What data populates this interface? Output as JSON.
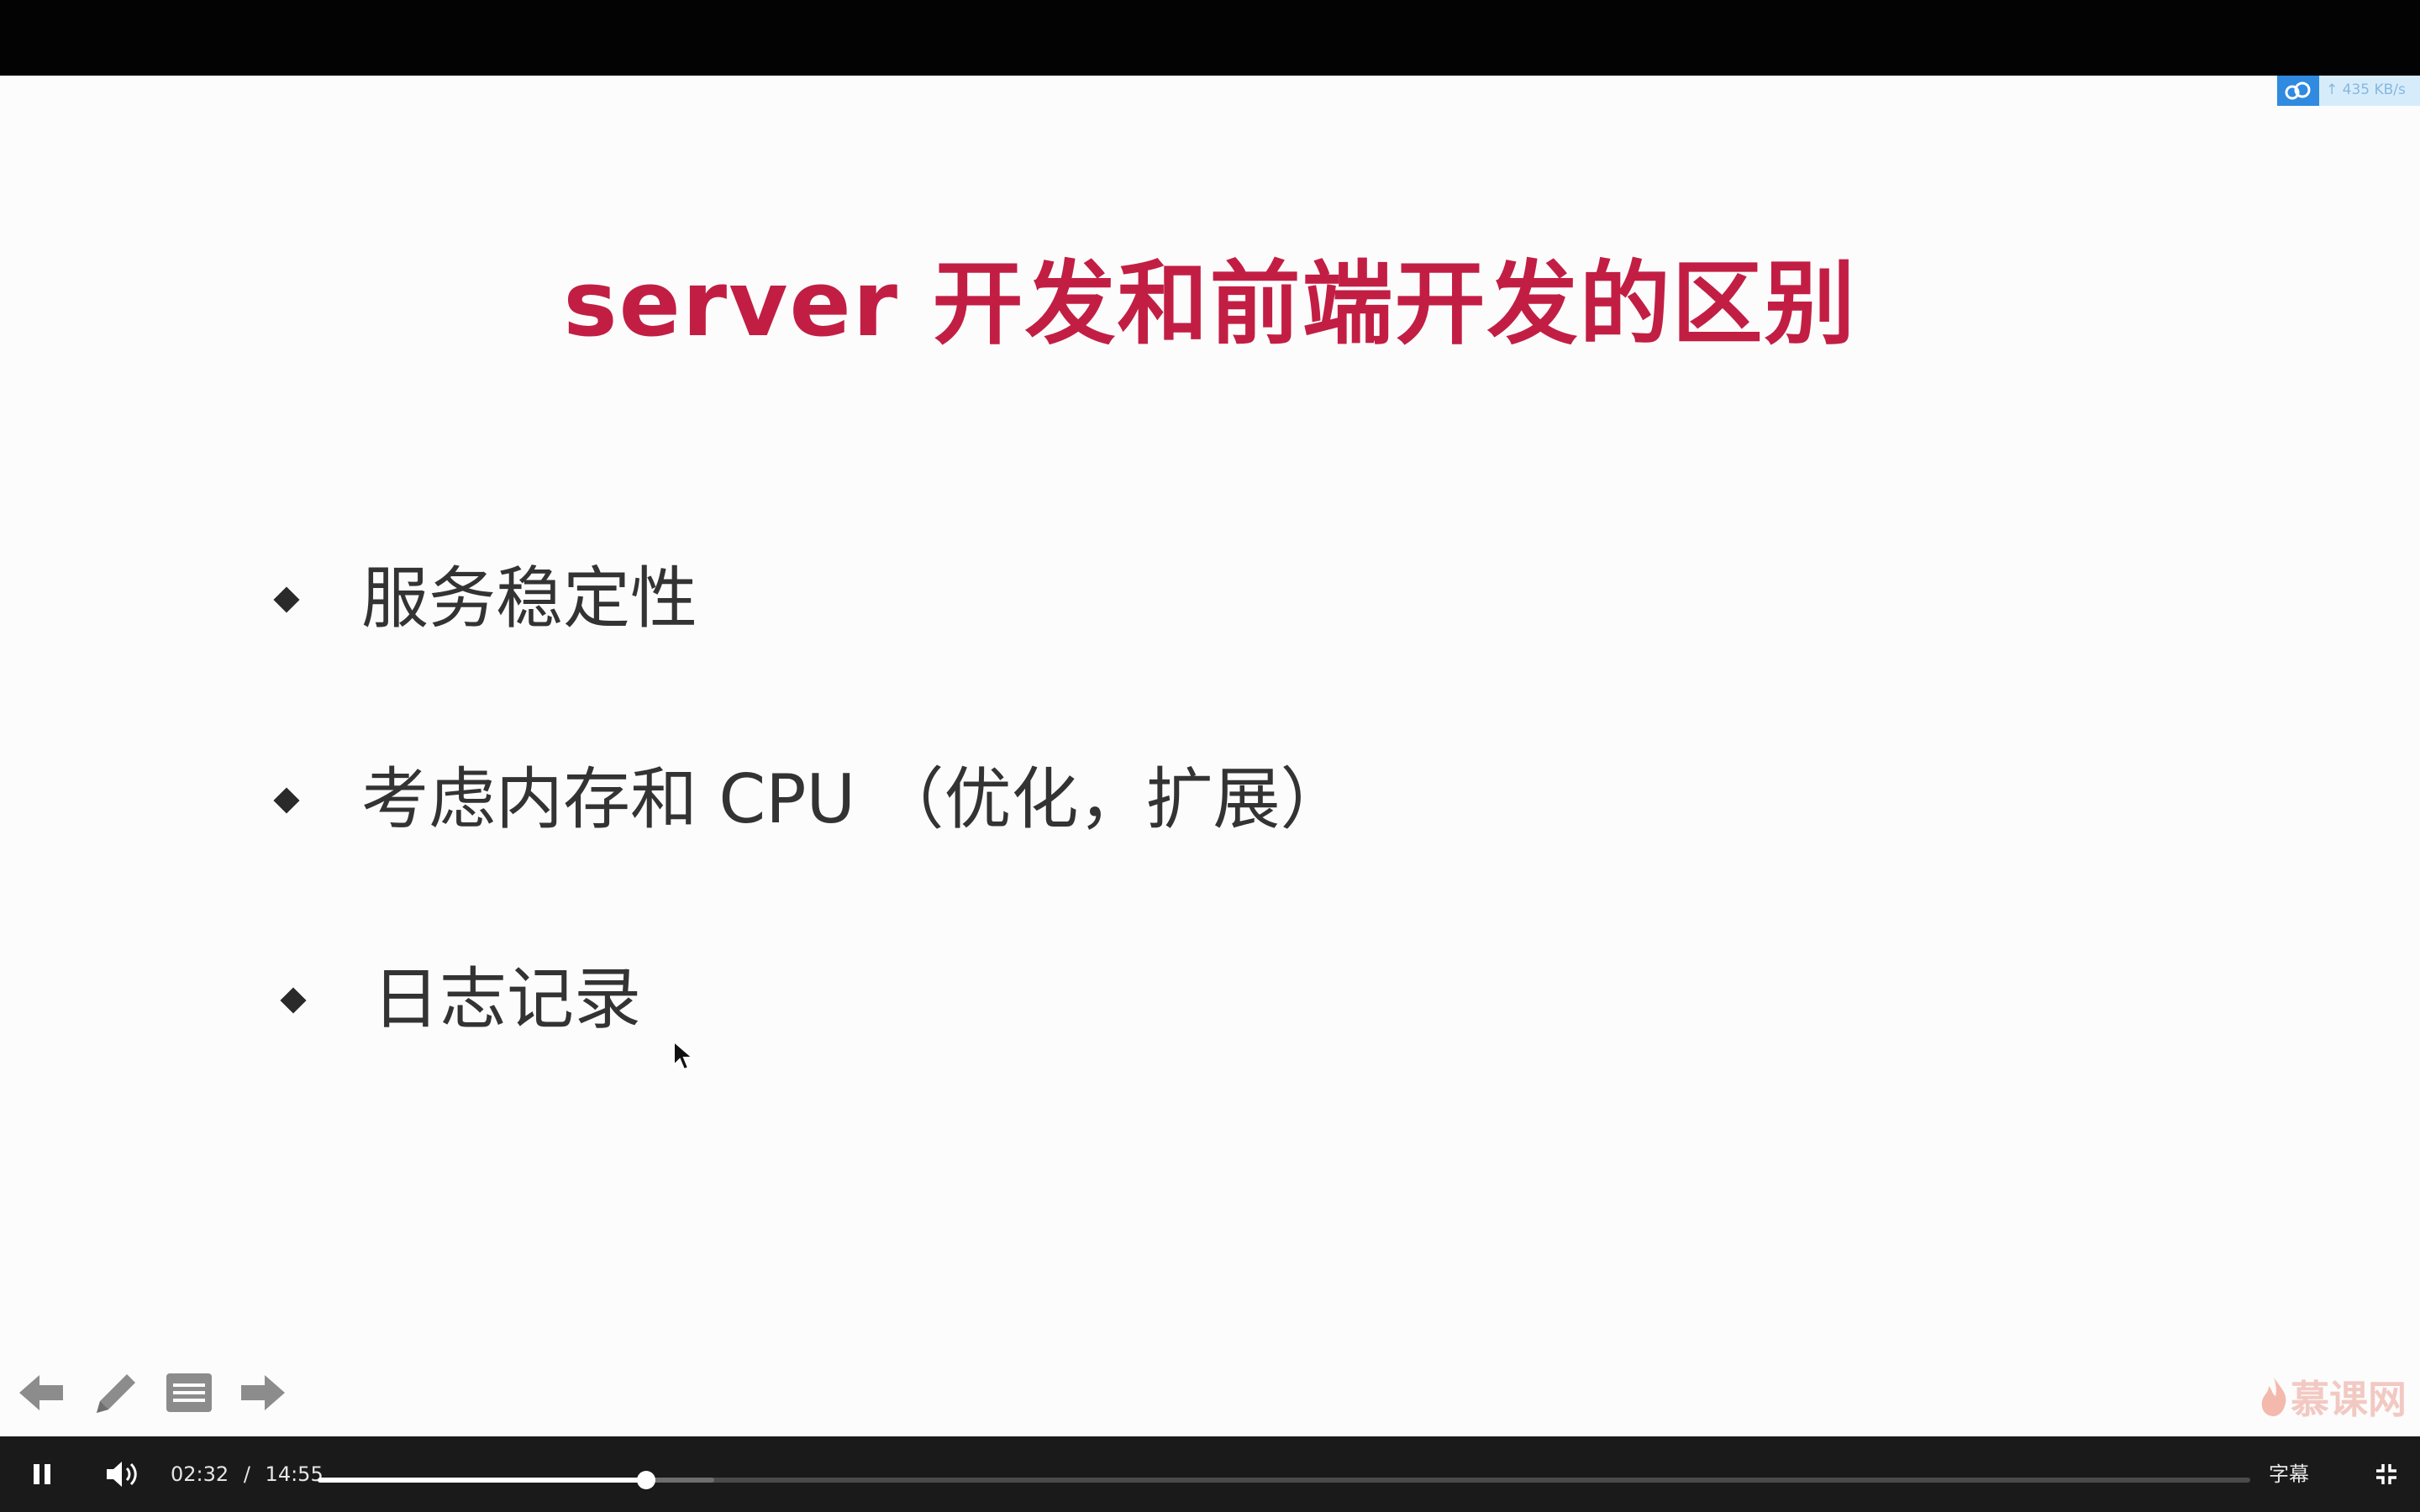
{
  "slide": {
    "title": "server 开发和前端开发的区别",
    "bullets": [
      {
        "text": "服务稳定性"
      },
      {
        "text": "考虑内存和 CPU （优化，扩展）"
      },
      {
        "text": "日志记录"
      }
    ],
    "tools": [
      {
        "icon": "arrow-left-icon"
      },
      {
        "icon": "pencil-icon"
      },
      {
        "icon": "notes-icon"
      },
      {
        "icon": "arrow-right-icon"
      }
    ],
    "watermark": "慕课网"
  },
  "net_badge": {
    "speed": "↑ 435 KB/s"
  },
  "player": {
    "current_time": "02:32",
    "separator": "/",
    "duration": "14:55",
    "progress_fraction": 0.17,
    "buffered_fraction": 0.205,
    "subtitle_label": "字幕"
  },
  "colors": {
    "title": "#c21e44",
    "bullet_text": "#333333",
    "slide_bg": "#fcfcfc",
    "controls_bg": "#1a1a1a"
  }
}
